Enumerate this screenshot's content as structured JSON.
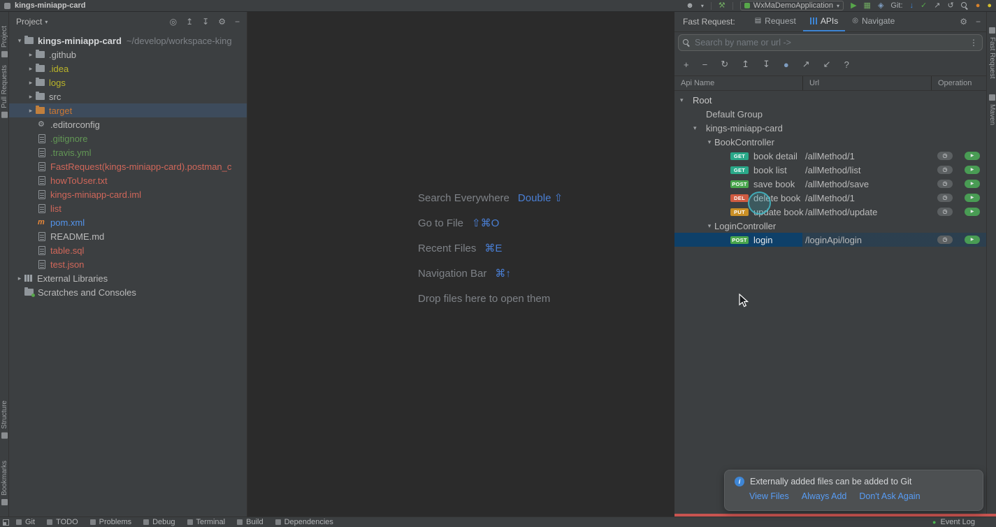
{
  "icons": {
    "chevron_down": "▾",
    "chevron_right": "▸",
    "caret_down": "▾",
    "gear": "⚙",
    "minus": "−",
    "plus": "+",
    "refresh": "↻",
    "expand_all": "↥",
    "collapse_all": "↧",
    "locate": "◎",
    "circle": "●",
    "export": "↗",
    "import": "↙",
    "help": "?",
    "kebab": "⋮",
    "play": "▶",
    "check": "✓",
    "arrow_down": "↓",
    "arrow_up_right": "↗",
    "undo": "↺",
    "clock": "◷",
    "send": "▶",
    "maven": "m",
    "info": "i",
    "user": "☻",
    "hammer": "⚒",
    "grid": "▦",
    "diamond": "◈",
    "dot": "●",
    "navigate": "◎",
    "request_tab": "▤"
  },
  "colors": {
    "link_blue": "#589DF6",
    "shortcut_blue": "#4A7FD5",
    "tab_accent": "#3E86D6",
    "file_default": "#BBBBBB",
    "file_red": "#D1675A",
    "file_green": "#629755",
    "file_blue": "#5394EC",
    "file_olive": "#BBB529",
    "file_orange": "#CC7832",
    "badge_get": "#2AA889",
    "badge_post": "#49A64C",
    "badge_del": "#CF5B41",
    "badge_put": "#C98F26",
    "run_green": "#57A64A",
    "update_blue": "#3E86D6",
    "warn_orange": "#D9822B",
    "yellow_dot": "#D6C02F"
  },
  "titlebar": {
    "title": "kings-miniapp-card",
    "run_config": "WxMaDemoApplication",
    "git_label": "Git:"
  },
  "left_stripe": {
    "items": [
      "Project",
      "Pull Requests",
      "Structure",
      "Bookmarks"
    ]
  },
  "right_stripe": {
    "items": [
      "Fast Request",
      "Maven"
    ]
  },
  "project": {
    "header": "Project",
    "root_name": "kings-miniapp-card",
    "root_path": "~/develop/workspace-king",
    "items": [
      {
        "name": ".github"
      },
      {
        "name": ".idea"
      },
      {
        "name": "logs"
      },
      {
        "name": "src"
      },
      {
        "name": "target"
      },
      {
        "name": ".editorconfig"
      },
      {
        "name": ".gitignore"
      },
      {
        "name": ".travis.yml"
      },
      {
        "name": "FastRequest(kings-miniapp-card).postman_c"
      },
      {
        "name": "howToUser.txt"
      },
      {
        "name": "kings-miniapp-card.iml"
      },
      {
        "name": "list"
      },
      {
        "name": "pom.xml"
      },
      {
        "name": "README.md"
      },
      {
        "name": "table.sql"
      },
      {
        "name": "test.json"
      },
      {
        "name": "External Libraries"
      },
      {
        "name": "Scratches and Consoles"
      }
    ]
  },
  "editor_shortcuts": [
    {
      "label": "Search Everywhere",
      "keys": "Double ⇧"
    },
    {
      "label": "Go to File",
      "keys": "⇧⌘O"
    },
    {
      "label": "Recent Files",
      "keys": "⌘E"
    },
    {
      "label": "Navigation Bar",
      "keys": "⌘↑"
    },
    {
      "label": "Drop files here to open them",
      "keys": ""
    }
  ],
  "fast_request": {
    "title": "Fast Request:",
    "tabs": [
      {
        "label": "Request"
      },
      {
        "label": "APIs"
      },
      {
        "label": "Navigate"
      }
    ],
    "search_placeholder": "Search by name or url ->",
    "columns": [
      "Api Name",
      "Url",
      "Operation"
    ],
    "tree": [
      {
        "label": "Root"
      },
      {
        "label": "Default Group"
      },
      {
        "label": "kings-miniapp-card"
      },
      {
        "label": "BookController"
      },
      {
        "method": "GET",
        "label": "book detail",
        "url": "/allMethod/1"
      },
      {
        "method": "GET",
        "label": "book list",
        "url": "/allMethod/list"
      },
      {
        "method": "POST",
        "label": "save book",
        "url": "/allMethod/save"
      },
      {
        "method": "DEL",
        "label": "delete book",
        "url": "/allMethod/1"
      },
      {
        "method": "PUT",
        "label": "update book",
        "url": "/allMethod/update"
      },
      {
        "label": "LoginController"
      },
      {
        "method": "POST",
        "label": "login",
        "url": "/loginApi/login"
      }
    ]
  },
  "notification": {
    "message": "Externally added files can be added to Git",
    "actions": [
      "View Files",
      "Always Add",
      "Don't Ask Again"
    ]
  },
  "bottom_bar": {
    "left_items": [
      "Git",
      "TODO",
      "Problems",
      "Debug",
      "Terminal",
      "Build",
      "Dependencies"
    ],
    "right_items": [
      "Event Log"
    ]
  }
}
